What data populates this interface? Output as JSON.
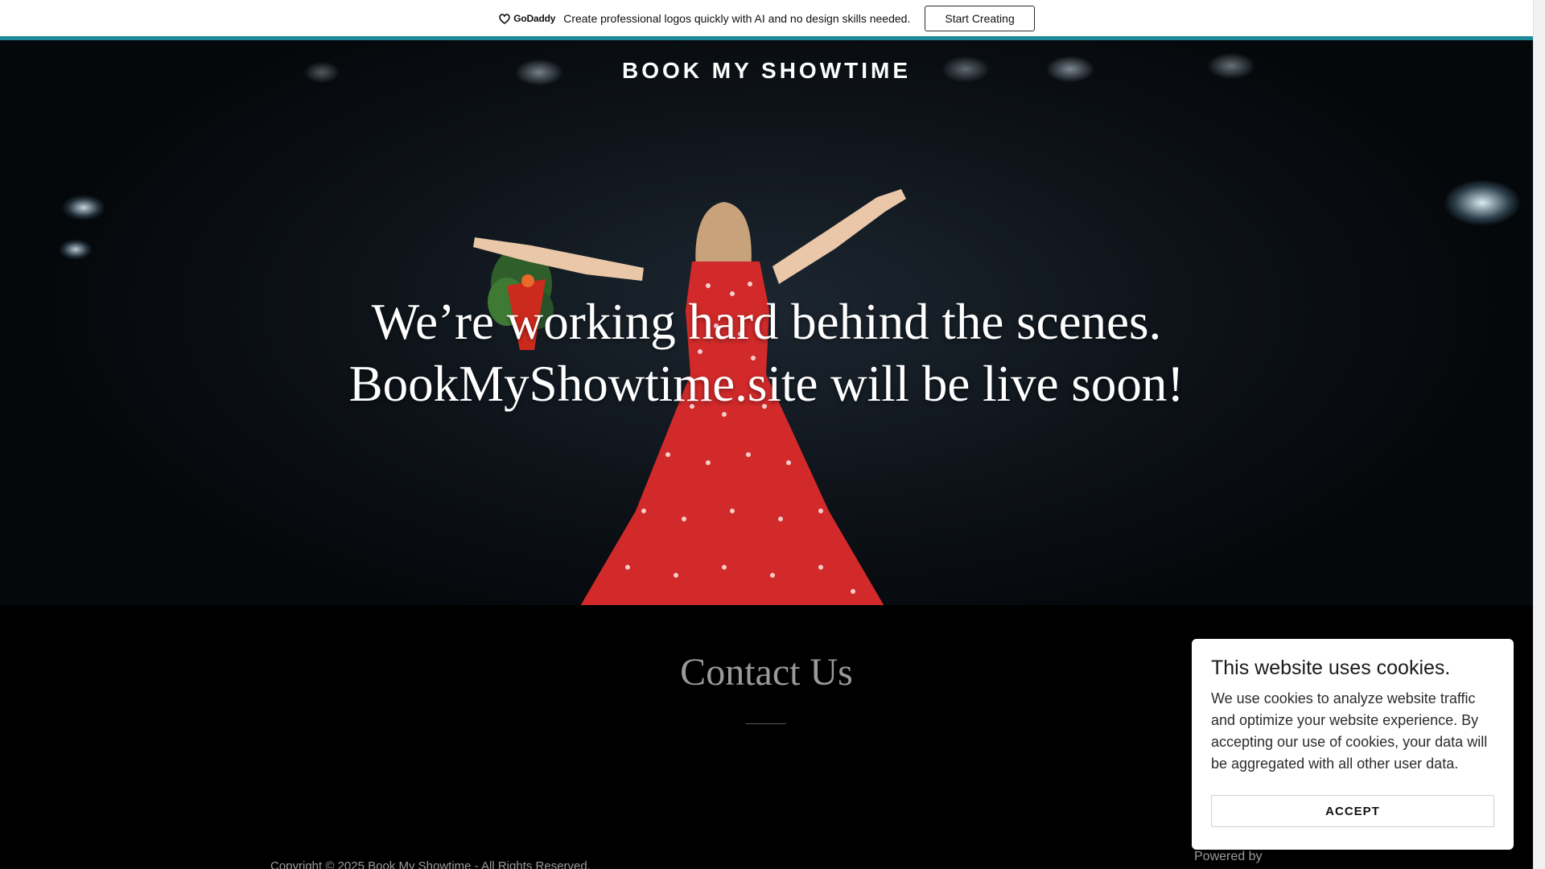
{
  "promo": {
    "brand": "GoDaddy",
    "text": "Create professional logos quickly with AI and no design skills needed.",
    "button_label": "Start Creating"
  },
  "hero": {
    "site_title": "BOOK MY SHOWTIME",
    "heading_line1": "We’re working hard behind the scenes.",
    "heading_line2": "BookMyShowtime.site will be live soon!"
  },
  "contact": {
    "title": "Contact Us"
  },
  "footer": {
    "copyright": "Copyright © 2025 Book My Showtime - All Rights Reserved.",
    "powered_by": "Powered by"
  },
  "cookie_banner": {
    "title": "This website uses cookies.",
    "body": "We use cookies to analyze website traffic and optimize your website experience. By accepting our use of cookies, your data will be aggregated with all other user data.",
    "accept_label": "ACCEPT"
  },
  "colors": {
    "promo_accent": "#1e8a99",
    "dress_red": "#d22a2a",
    "page_background": "#000000"
  }
}
